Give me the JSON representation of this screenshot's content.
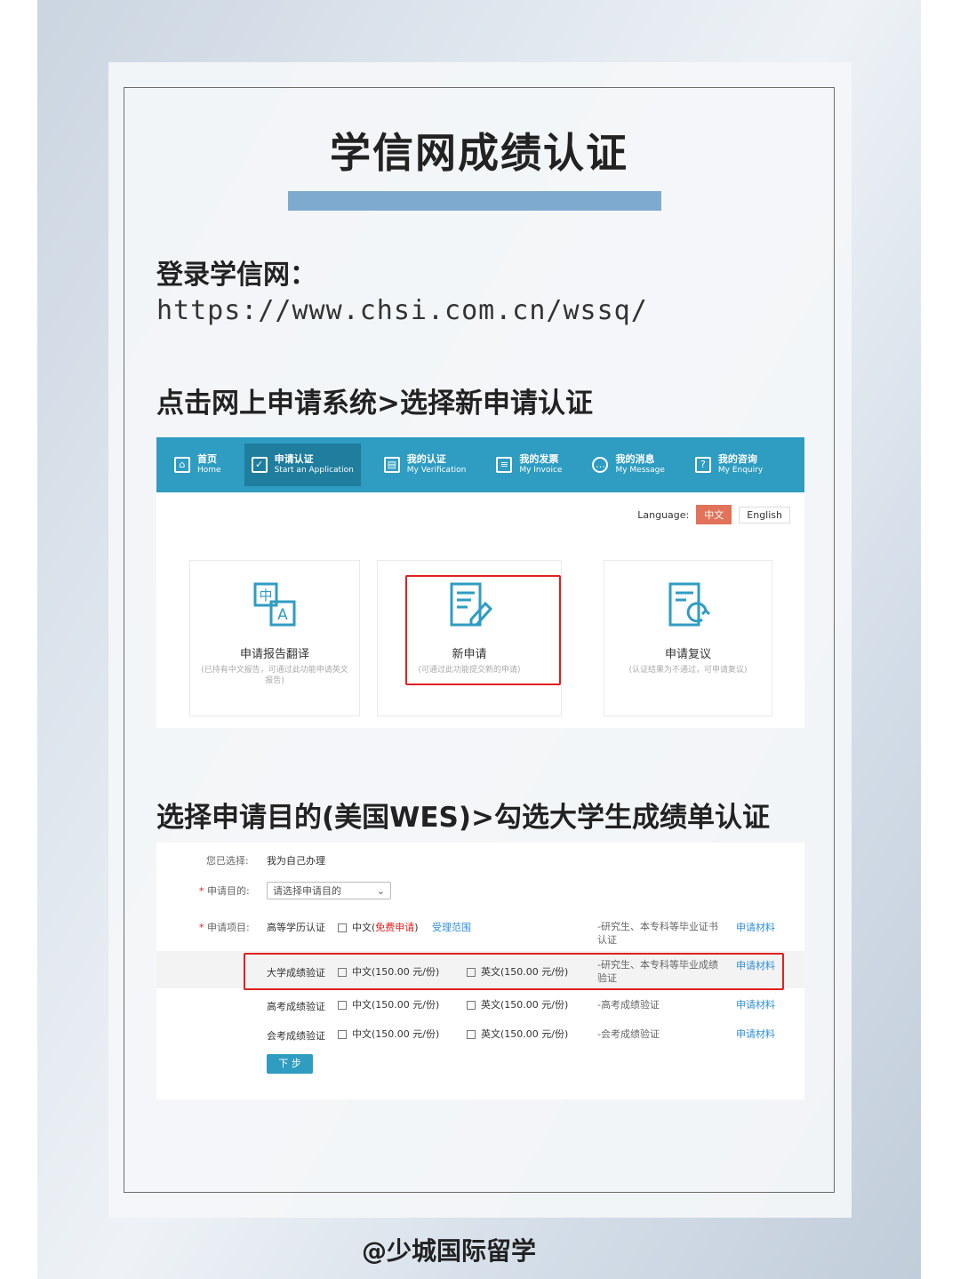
{
  "title": "学信网成绩认证",
  "step1": {
    "heading": "登录学信网：",
    "url": "https://www.chsi.com.cn/wssq/"
  },
  "step2": {
    "heading": "点击网上申请系统>选择新申请认证"
  },
  "step3": {
    "heading": "选择申请目的(美国WES)>勾选大学生成绩单认证"
  },
  "nav": [
    {
      "cn": "首页",
      "en": "Home",
      "icon": "home-icon"
    },
    {
      "cn": "申请认证",
      "en": "Start an Application",
      "icon": "check-icon"
    },
    {
      "cn": "我的认证",
      "en": "My Verification",
      "icon": "verification-icon"
    },
    {
      "cn": "我的发票",
      "en": "My Invoice",
      "icon": "invoice-icon"
    },
    {
      "cn": "我的消息",
      "en": "My Message",
      "icon": "message-icon"
    },
    {
      "cn": "我的咨询",
      "en": "My Enquiry",
      "icon": "enquiry-icon"
    }
  ],
  "language": {
    "label": "Language:",
    "zh": "中文",
    "en": "English"
  },
  "cards": [
    {
      "title": "申请报告翻译",
      "desc": "(已持有中文报告，可通过此功能申请英文报告)",
      "icon": "translate-icon"
    },
    {
      "title": "新申请",
      "desc": "(可通过此功能提交新的申请)",
      "icon": "new-application-icon"
    },
    {
      "title": "申请复议",
      "desc": "(认证结果为不通过，可申请复议)",
      "icon": "review-icon"
    }
  ],
  "form": {
    "selected_label": "您已选择:",
    "selected_value": "我为自己办理",
    "purpose_label": "申请目的:",
    "purpose_placeholder": "请选择申请目的",
    "project_label": "申请项目:",
    "rows": [
      {
        "name": "高等学历认证",
        "opt1_prefix": "中文(",
        "opt1_free": "免费申请",
        "opt1_suffix": ")",
        "extra_link": "受理范围",
        "note": "-研究生、本专科等毕业证书认证",
        "material": "申请材料"
      },
      {
        "name": "大学成绩验证",
        "opt1": "中文(150.00 元/份)",
        "opt2": "英文(150.00 元/份)",
        "note": "-研究生、本专科等毕业成绩验证",
        "material": "申请材料"
      },
      {
        "name": "高考成绩验证",
        "opt1": "中文(150.00 元/份)",
        "opt2": "英文(150.00 元/份)",
        "note": "-高考成绩验证",
        "material": "申请材料"
      },
      {
        "name": "会考成绩验证",
        "opt1": "中文(150.00 元/份)",
        "opt2": "英文(150.00 元/份)",
        "note": "-会考成绩验证",
        "material": "申请材料"
      }
    ],
    "next_button": "下 步"
  },
  "footer": "@少城国际留学"
}
